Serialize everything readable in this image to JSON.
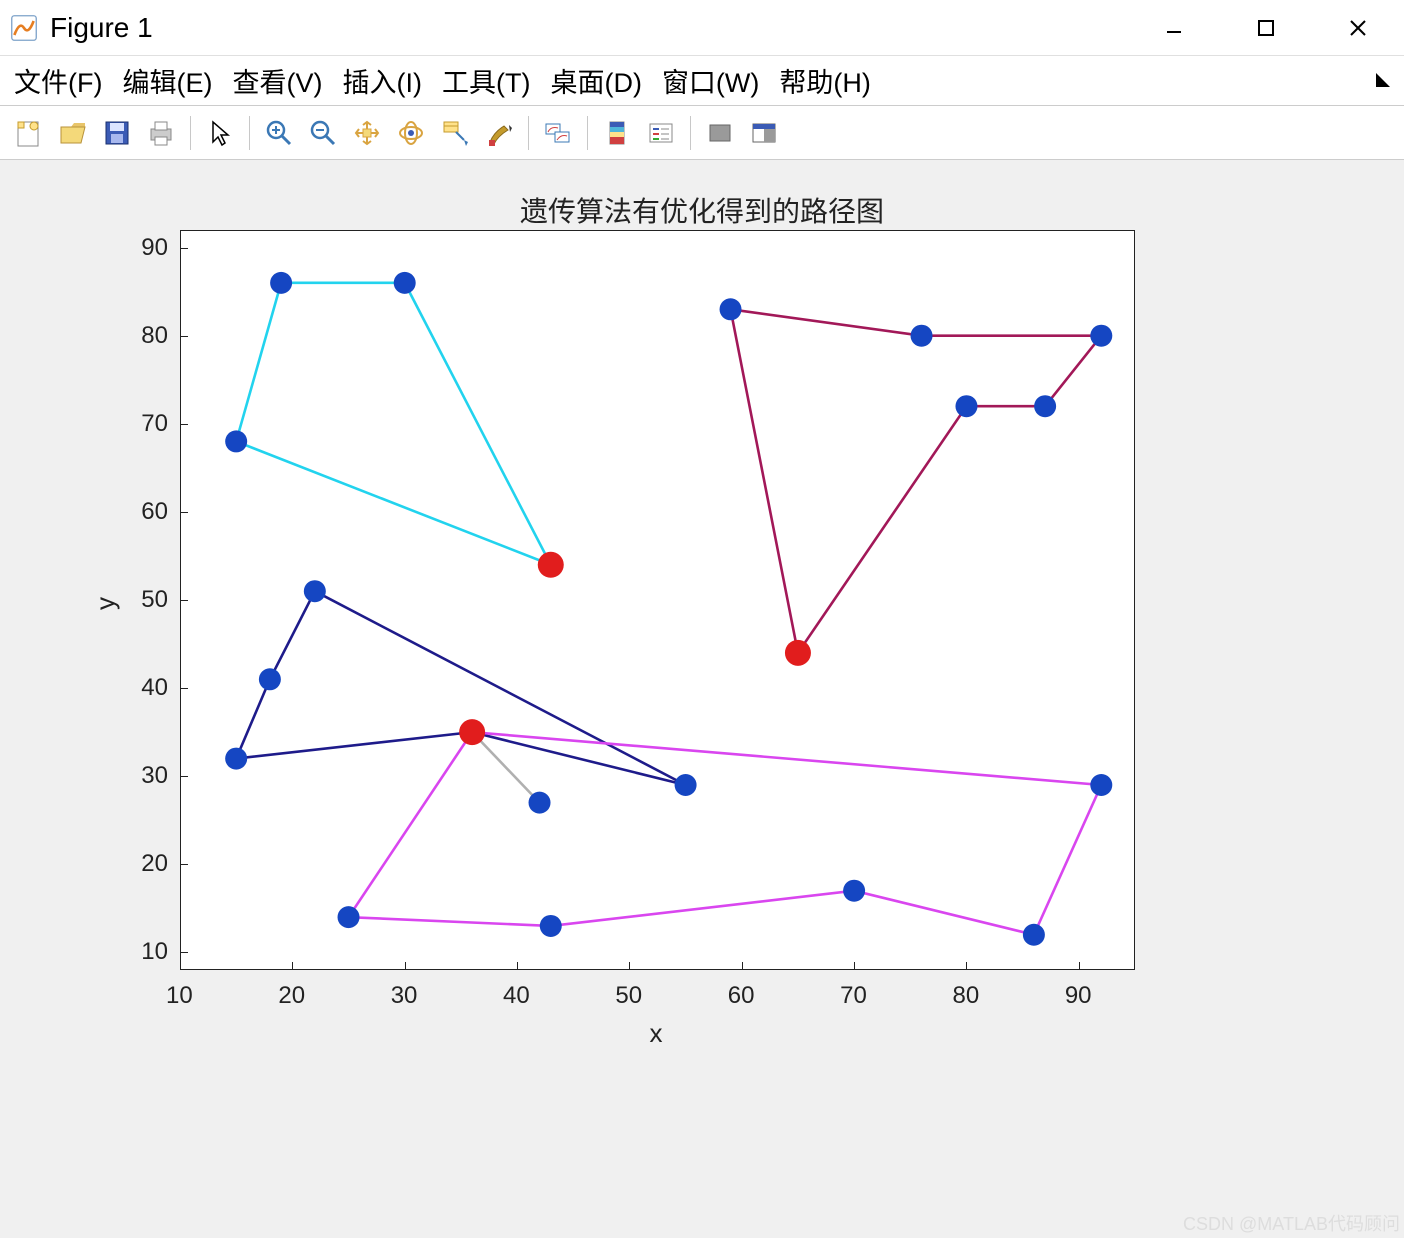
{
  "window": {
    "title": "Figure 1",
    "minimize_tooltip": "Minimize",
    "maximize_tooltip": "Maximize",
    "close_tooltip": "Close"
  },
  "menu": {
    "file": "文件(F)",
    "edit": "编辑(E)",
    "view": "查看(V)",
    "insert": "插入(I)",
    "tools": "工具(T)",
    "desktop": "桌面(D)",
    "window": "窗口(W)",
    "help": "帮助(H)"
  },
  "toolbar_icons": [
    "new-figure-icon",
    "open-file-icon",
    "save-icon",
    "print-icon",
    "|",
    "pointer-icon",
    "|",
    "zoom-in-icon",
    "zoom-out-icon",
    "pan-icon",
    "rotate3d-icon",
    "data-cursor-icon",
    "brush-icon",
    "|",
    "link-plots-icon",
    "|",
    "colorbar-icon",
    "legend-icon",
    "|",
    "hide-tools-icon",
    "dock-icon"
  ],
  "watermark": "CSDN @MATLAB代码顾问",
  "chart_data": {
    "type": "scatter",
    "title": "遗传算法有优化得到的路径图",
    "xlabel": "x",
    "ylabel": "y",
    "xlim": [
      10,
      95
    ],
    "ylim": [
      8,
      92
    ],
    "xticks": [
      10,
      20,
      30,
      40,
      50,
      60,
      70,
      80,
      90
    ],
    "yticks": [
      10,
      20,
      30,
      40,
      50,
      60,
      70,
      80,
      90
    ],
    "series": [
      {
        "name": "path-cyan",
        "color": "#22d3ee",
        "closed": true,
        "points": [
          [
            43,
            54
          ],
          [
            30,
            86
          ],
          [
            19,
            86
          ],
          [
            15,
            68
          ]
        ]
      },
      {
        "name": "path-navy",
        "color": "#1e1b8a",
        "closed": false,
        "points": [
          [
            36,
            35
          ],
          [
            15,
            32
          ],
          [
            18,
            41
          ],
          [
            22,
            51
          ],
          [
            55,
            29
          ],
          [
            36,
            35
          ]
        ]
      },
      {
        "name": "path-gray",
        "color": "#b0b0b0",
        "closed": false,
        "points": [
          [
            36,
            35
          ],
          [
            42,
            27
          ]
        ]
      },
      {
        "name": "path-magenta",
        "color": "#d946ef",
        "closed": false,
        "points": [
          [
            36,
            35
          ],
          [
            92,
            29
          ],
          [
            86,
            12
          ],
          [
            70,
            17
          ],
          [
            43,
            13
          ],
          [
            25,
            14
          ],
          [
            36,
            35
          ]
        ]
      },
      {
        "name": "path-maroon",
        "color": "#a21858",
        "closed": false,
        "points": [
          [
            65,
            44
          ],
          [
            59,
            83
          ],
          [
            76,
            80
          ],
          [
            92,
            80
          ],
          [
            87,
            72
          ],
          [
            80,
            72
          ],
          [
            65,
            44
          ]
        ]
      }
    ],
    "blue_nodes": [
      [
        19,
        86
      ],
      [
        30,
        86
      ],
      [
        15,
        68
      ],
      [
        22,
        51
      ],
      [
        18,
        41
      ],
      [
        15,
        32
      ],
      [
        55,
        29
      ],
      [
        42,
        27
      ],
      [
        59,
        83
      ],
      [
        76,
        80
      ],
      [
        92,
        80
      ],
      [
        80,
        72
      ],
      [
        87,
        72
      ],
      [
        92,
        29
      ],
      [
        70,
        17
      ],
      [
        86,
        12
      ],
      [
        43,
        13
      ],
      [
        25,
        14
      ]
    ],
    "red_nodes": [
      [
        43,
        54
      ],
      [
        65,
        44
      ],
      [
        36,
        35
      ]
    ]
  }
}
